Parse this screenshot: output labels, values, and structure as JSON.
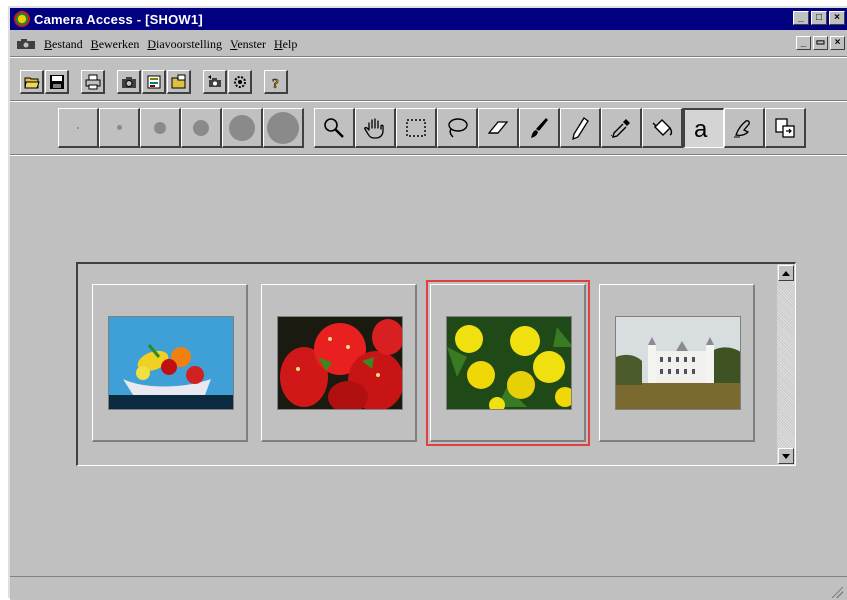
{
  "window": {
    "title": "Camera Access - [SHOW1]",
    "controls": {
      "minimize": "_",
      "maximize": "□",
      "close": "×"
    }
  },
  "menubar": {
    "items": [
      "Bestand",
      "Bewerken",
      "Diavoorstelling",
      "Venster",
      "Help"
    ],
    "mdi_controls": {
      "minimize": "_",
      "restore": "▭",
      "close": "×"
    }
  },
  "toolbar": {
    "groups": [
      [
        "open-folder-icon",
        "save-icon"
      ],
      [
        "print-icon"
      ],
      [
        "camera-icon",
        "slideshow-icon",
        "open-album-icon"
      ],
      [
        "camera-transfer-icon",
        "settings-icon"
      ],
      [
        "help-icon"
      ]
    ]
  },
  "drawing_toolbar": {
    "brush_sizes": [
      1,
      2,
      3,
      4,
      5,
      6
    ],
    "tools": [
      "zoom-icon",
      "hand-icon",
      "select-rect-icon",
      "lasso-icon",
      "eraser-icon",
      "brush-icon",
      "pencil-icon",
      "eyedropper-icon",
      "fill-icon",
      "text-icon",
      "smudge-icon",
      "paste-icon"
    ],
    "active_tool": "text-icon",
    "text_tool_glyph": "a"
  },
  "thumbnails": [
    {
      "subject": "fruit bowl",
      "selected": false
    },
    {
      "subject": "strawberries",
      "selected": false
    },
    {
      "subject": "dandelions",
      "selected": true
    },
    {
      "subject": "castle",
      "selected": false
    }
  ],
  "colors": {
    "title_bar": "#000080",
    "face": "#c0c0c0",
    "selection": "#e04040"
  }
}
